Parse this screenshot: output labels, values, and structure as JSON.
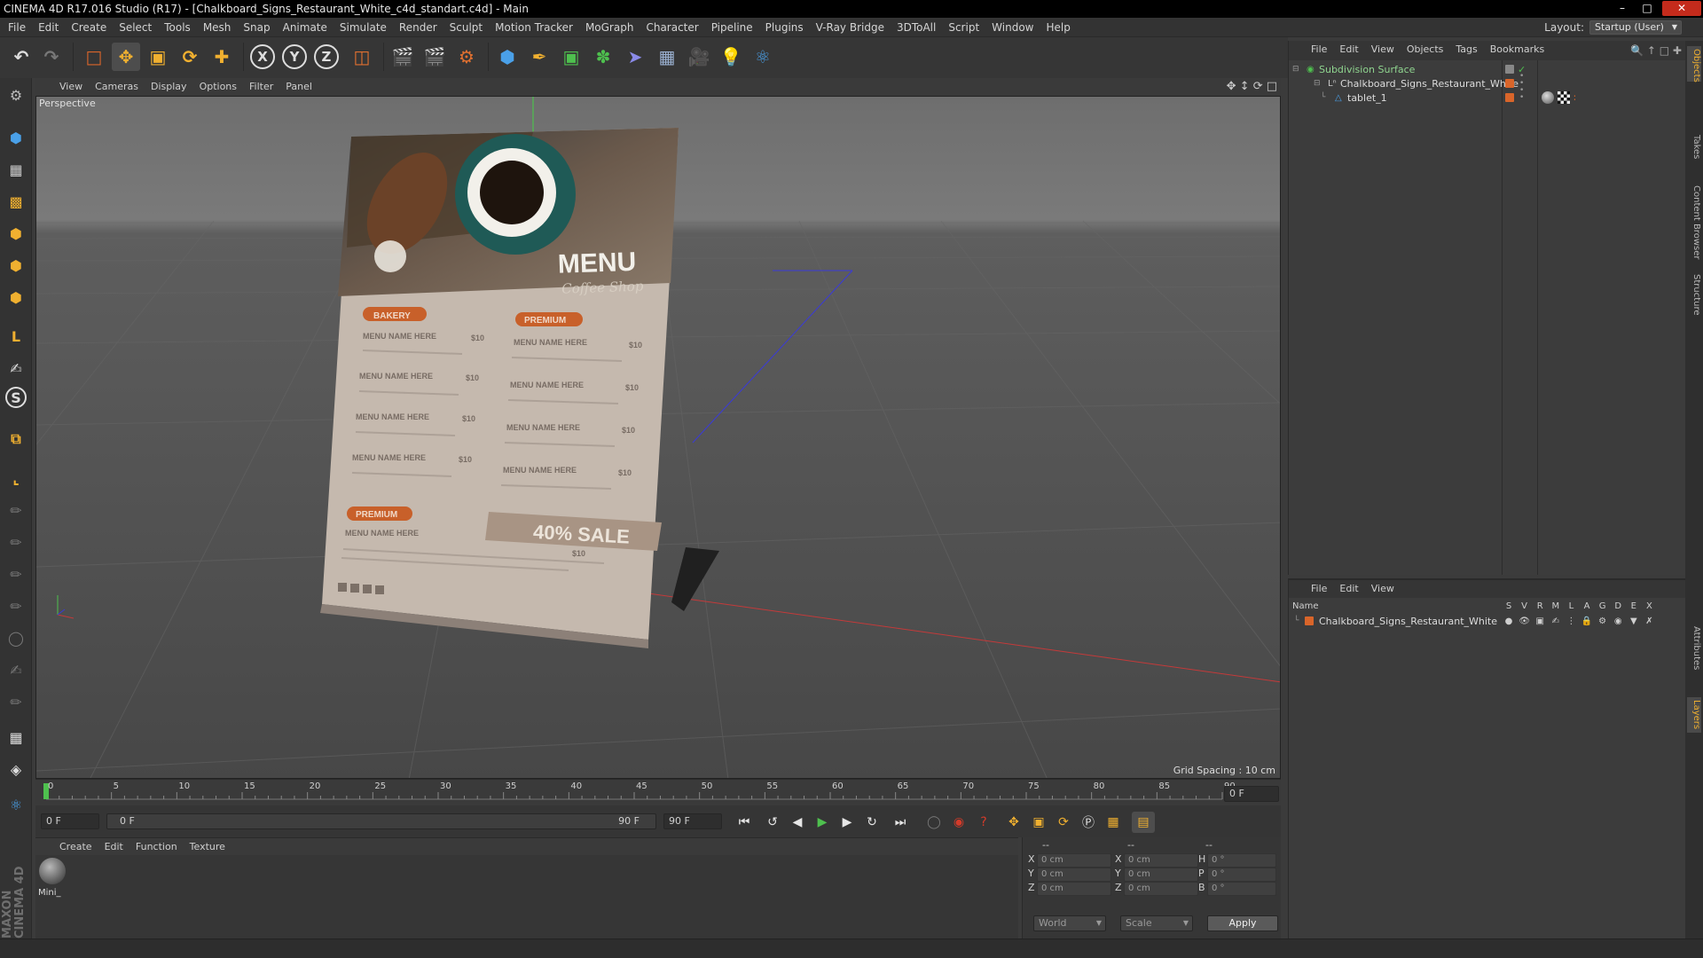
{
  "window": {
    "title": "CINEMA 4D R17.016 Studio (R17) - [Chalkboard_Signs_Restaurant_White_c4d_standart.c4d] - Main",
    "controls": [
      "minimize",
      "maximize",
      "close"
    ]
  },
  "menubar": {
    "items": [
      "File",
      "Edit",
      "Create",
      "Select",
      "Tools",
      "Mesh",
      "Snap",
      "Animate",
      "Simulate",
      "Render",
      "Sculpt",
      "Motion Tracker",
      "MoGraph",
      "Character",
      "Pipeline",
      "Plugins",
      "V-Ray Bridge",
      "3DToAll",
      "Script",
      "Window",
      "Help"
    ],
    "layout_label": "Layout:",
    "layout_value": "Startup (User)"
  },
  "toolbar": {
    "axis_x": "X",
    "axis_y": "Y",
    "axis_z": "Z"
  },
  "viewport": {
    "menu": [
      "View",
      "Cameras",
      "Display",
      "Options",
      "Filter",
      "Panel"
    ],
    "camera_label": "Perspective",
    "grid_spacing": "Grid Spacing : 10 cm",
    "menu_card": {
      "title": "MENU",
      "subtitle": "Coffee Shop",
      "section_left": "BAKERY",
      "section_right": "PREMIUM",
      "section_bottom": "PREMIUM",
      "item_name": "MENU NAME HERE",
      "price": "$10",
      "sale": "40% SALE"
    }
  },
  "timeline": {
    "ticks": [
      "0",
      "5",
      "10",
      "15",
      "20",
      "25",
      "30",
      "35",
      "40",
      "45",
      "50",
      "55",
      "60",
      "65",
      "70",
      "75",
      "80",
      "85",
      "90"
    ],
    "current_frame_field": "0 F"
  },
  "transport": {
    "start_field": "0 F",
    "range_start": "0 F",
    "range_end": "90 F",
    "end_field": "90 F"
  },
  "material_manager": {
    "menu": [
      "Create",
      "Edit",
      "Function",
      "Texture"
    ],
    "materials": [
      {
        "name": "Mini_"
      }
    ]
  },
  "coordinates": {
    "headers": [
      "--",
      "--",
      "--"
    ],
    "rows": [
      {
        "a": "X",
        "a_val": "0 cm",
        "b": "X",
        "b_val": "0 cm",
        "c": "H",
        "c_val": "0 °"
      },
      {
        "a": "Y",
        "a_val": "0 cm",
        "b": "Y",
        "b_val": "0 cm",
        "c": "P",
        "c_val": "0 °"
      },
      {
        "a": "Z",
        "a_val": "0 cm",
        "b": "Z",
        "b_val": "0 cm",
        "c": "B",
        "c_val": "0 °"
      }
    ],
    "space_select": "World",
    "mode_select": "Scale",
    "apply_label": "Apply"
  },
  "object_manager": {
    "menu": [
      "File",
      "Edit",
      "View",
      "Objects",
      "Tags",
      "Bookmarks"
    ],
    "objects": [
      {
        "name": "Subdivision Surface",
        "color": "#8fd48f"
      },
      {
        "name": "Chalkboard_Signs_Restaurant_White",
        "color": "#dcdcdc"
      },
      {
        "name": "tablet_1",
        "color": "#dcdcdc"
      }
    ]
  },
  "layer_manager": {
    "menu": [
      "File",
      "Edit",
      "View"
    ],
    "header_name": "Name",
    "columns": [
      "S",
      "V",
      "R",
      "M",
      "L",
      "A",
      "G",
      "D",
      "E",
      "X"
    ],
    "layers": [
      {
        "name": "Chalkboard_Signs_Restaurant_White",
        "color": "#d9652a"
      }
    ]
  },
  "side_tabs": [
    "Objects",
    "Takes",
    "Content Browser",
    "Structure",
    "Attributes",
    "Layers"
  ],
  "branding": {
    "logo_text": "MAXON CINEMA 4D"
  },
  "colors": {
    "accent": "#d9652a",
    "selection_blue": "#4a8fd8",
    "play_green": "#4ec04e",
    "record_red": "#d43b2a"
  }
}
